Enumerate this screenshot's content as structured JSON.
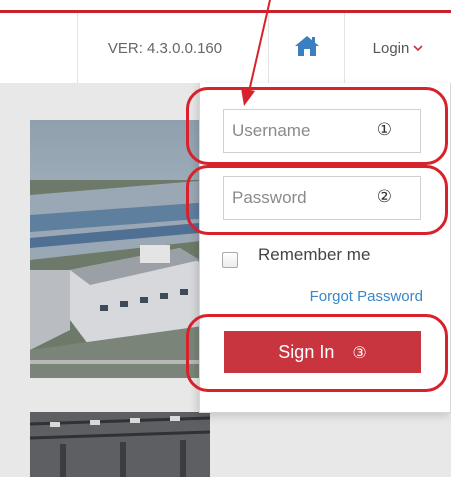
{
  "header": {
    "version": "VER: 4.3.0.0.160",
    "home_icon": "home-icon",
    "login_label": "Login",
    "login_caret_icon": "chevron-down-icon"
  },
  "login_form": {
    "username": {
      "placeholder": "Username",
      "marker": "①"
    },
    "password": {
      "placeholder": "Password",
      "marker": "②"
    },
    "remember_label": "Remember me",
    "forgot_label": "Forgot Password",
    "signin_label": "Sign In",
    "signin_marker": "③"
  },
  "colors": {
    "accent": "#c9353f",
    "annotation": "#d8222b",
    "link": "#3a86c8",
    "home_icon": "#3a7fc1"
  }
}
